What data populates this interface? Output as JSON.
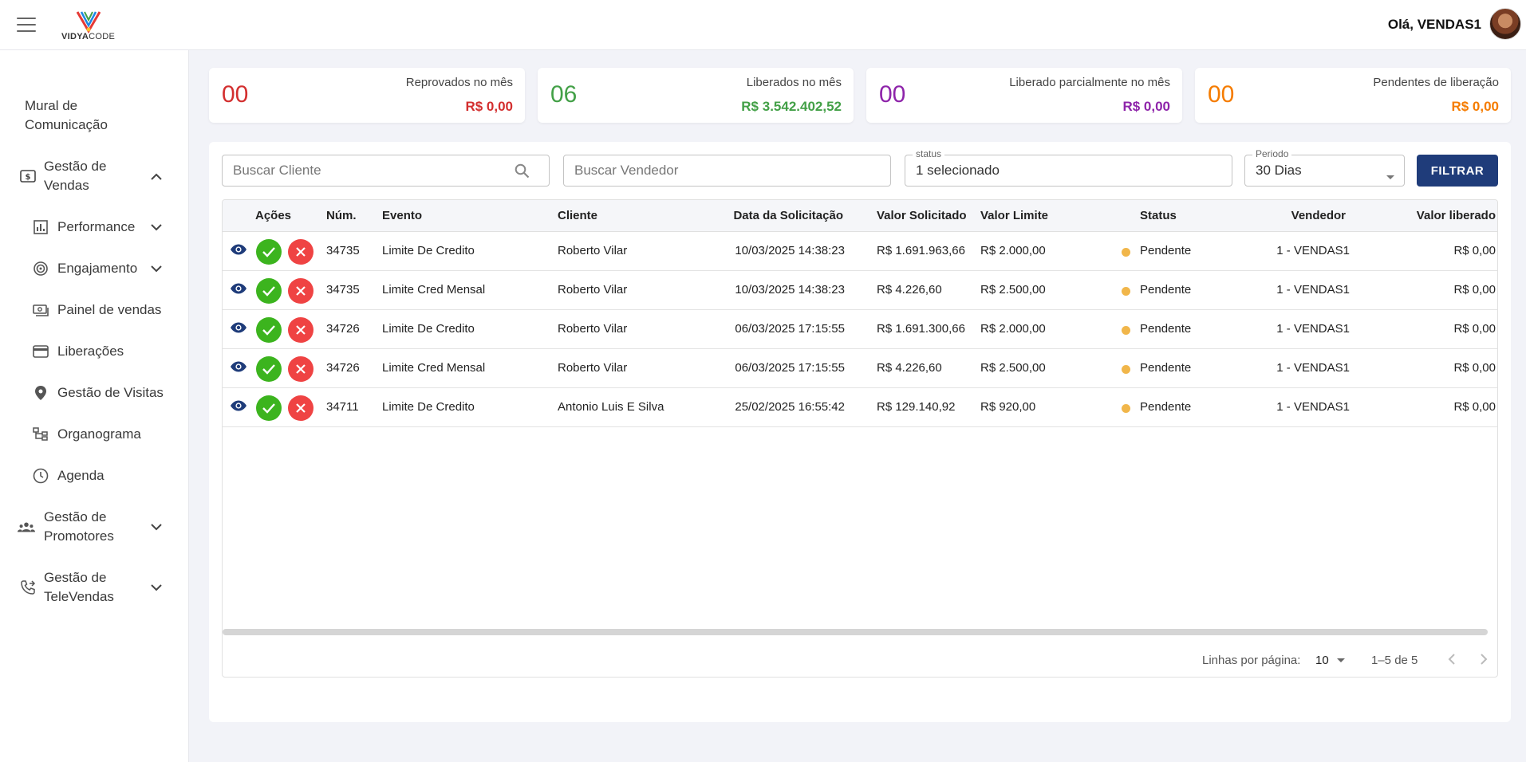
{
  "header": {
    "logo_bold": "VIDYA",
    "logo_light": "CODE",
    "greeting": "Olá, VENDAS1"
  },
  "sidebar": {
    "items": [
      {
        "label": "Mural de Comunicação"
      },
      {
        "label": "Gestão de Vendas"
      },
      {
        "label": "Performance"
      },
      {
        "label": "Engajamento"
      },
      {
        "label": "Painel de vendas"
      },
      {
        "label": "Liberações"
      },
      {
        "label": "Gestão de Visitas"
      },
      {
        "label": "Organograma"
      },
      {
        "label": "Agenda"
      },
      {
        "label": "Gestão de Promotores"
      },
      {
        "label": "Gestão de TeleVendas"
      }
    ]
  },
  "stats": [
    {
      "count": "00",
      "title": "Reprovados no mês",
      "value": "R$ 0,00",
      "color": "#d32f2f"
    },
    {
      "count": "06",
      "title": "Liberados no mês",
      "value": "R$ 3.542.402,52",
      "color": "#43a047"
    },
    {
      "count": "00",
      "title": "Liberado parcialmente no mês",
      "value": "R$ 0,00",
      "color": "#8e24aa"
    },
    {
      "count": "00",
      "title": "Pendentes de liberação",
      "value": "R$ 0,00",
      "color": "#f57c00"
    }
  ],
  "filters": {
    "cliente_placeholder": "Buscar Cliente",
    "vendedor_placeholder": "Buscar Vendedor",
    "status_label": "status",
    "status_value": "1 selecionado",
    "periodo_label": "Periodo",
    "periodo_value": "30 Dias",
    "filter_button": "FILTRAR"
  },
  "table": {
    "headers": [
      "Ações",
      "Núm.",
      "Evento",
      "Cliente",
      "Data da Solicitação",
      "Valor Solicitado",
      "Valor Limite",
      "Status",
      "Vendedor",
      "Valor liberado"
    ],
    "rows": [
      {
        "num": "34735",
        "evento": "Limite De Credito",
        "cliente": "Roberto Vilar",
        "data": "10/03/2025 14:38:23",
        "solicitado": "R$ 1.691.963,66",
        "limite": "R$ 2.000,00",
        "status": "Pendente",
        "vendedor": "1 - VENDAS1",
        "liberado": "R$ 0,00"
      },
      {
        "num": "34735",
        "evento": "Limite Cred Mensal",
        "cliente": "Roberto Vilar",
        "data": "10/03/2025 14:38:23",
        "solicitado": "R$ 4.226,60",
        "limite": "R$ 2.500,00",
        "status": "Pendente",
        "vendedor": "1 - VENDAS1",
        "liberado": "R$ 0,00"
      },
      {
        "num": "34726",
        "evento": "Limite De Credito",
        "cliente": "Roberto Vilar",
        "data": "06/03/2025 17:15:55",
        "solicitado": "R$ 1.691.300,66",
        "limite": "R$ 2.000,00",
        "status": "Pendente",
        "vendedor": "1 - VENDAS1",
        "liberado": "R$ 0,00"
      },
      {
        "num": "34726",
        "evento": "Limite Cred Mensal",
        "cliente": "Roberto Vilar",
        "data": "06/03/2025 17:15:55",
        "solicitado": "R$ 4.226,60",
        "limite": "R$ 2.500,00",
        "status": "Pendente",
        "vendedor": "1 - VENDAS1",
        "liberado": "R$ 0,00"
      },
      {
        "num": "34711",
        "evento": "Limite De Credito",
        "cliente": "Antonio Luis E Silva",
        "data": "25/02/2025 16:55:42",
        "solicitado": "R$ 129.140,92",
        "limite": "R$ 920,00",
        "status": "Pendente",
        "vendedor": "1 - VENDAS1",
        "liberado": "R$ 0,00"
      }
    ]
  },
  "pagination": {
    "rows_label": "Linhas por página:",
    "rows_value": "10",
    "range": "1–5 de 5"
  },
  "colors": {
    "primary": "#1f3c7a",
    "approve": "#3cb41e",
    "reject": "#ef4343",
    "pending_dot": "#f1b64a"
  }
}
